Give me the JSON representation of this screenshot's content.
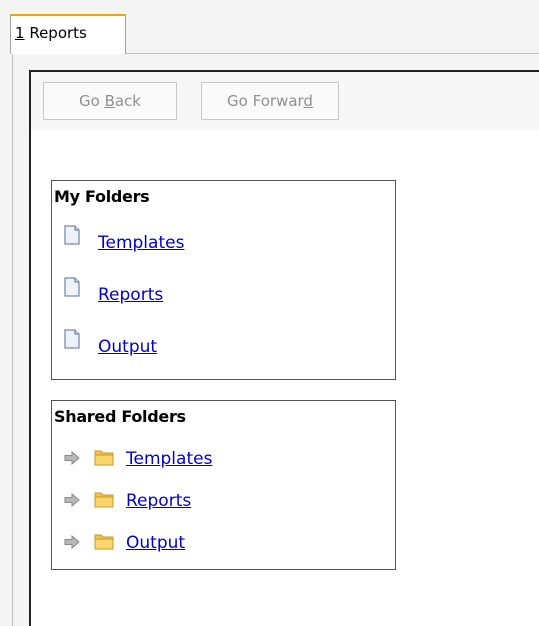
{
  "tabs": [
    {
      "mnemonic": "1",
      "label": " Reports"
    }
  ],
  "toolbar": {
    "back": {
      "pre": "Go ",
      "mnemonic": "B",
      "post": "ack"
    },
    "forward": {
      "pre": "Go Forwar",
      "mnemonic": "d",
      "post": ""
    }
  },
  "my_folders": {
    "title": "My Folders",
    "items": [
      {
        "label": "Templates",
        "icon": "document-icon"
      },
      {
        "label": "Reports",
        "icon": "document-icon"
      },
      {
        "label": "Output",
        "icon": "document-icon"
      }
    ]
  },
  "shared_folders": {
    "title": "Shared Folders",
    "items": [
      {
        "label": "Templates",
        "icon": "folder-icon",
        "expander": "arrow-right-icon"
      },
      {
        "label": "Reports",
        "icon": "folder-icon",
        "expander": "arrow-right-icon"
      },
      {
        "label": "Output",
        "icon": "folder-icon",
        "expander": "arrow-right-icon"
      }
    ]
  },
  "colors": {
    "tab_accent": "#f0a30a",
    "link": "#0000cc",
    "disabled_text": "#909090",
    "folder": "#f5c542"
  }
}
